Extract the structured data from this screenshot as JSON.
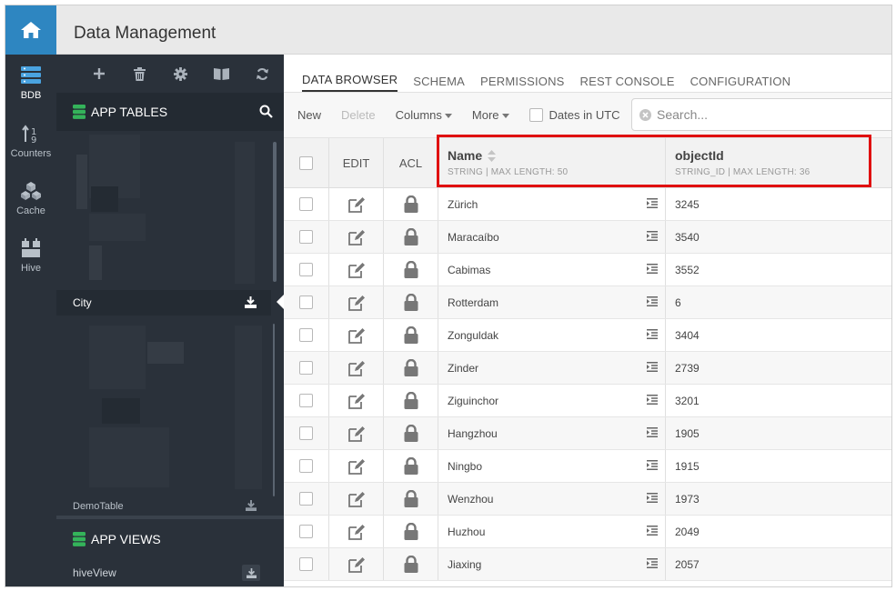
{
  "header": {
    "title": "Data Management"
  },
  "rail": {
    "items": [
      {
        "label": "BDB",
        "icon": "database-icon"
      },
      {
        "label": "Counters",
        "icon": "counters-icon"
      },
      {
        "label": "Cache",
        "icon": "cubes-icon"
      },
      {
        "label": "Hive",
        "icon": "hive-icon"
      }
    ]
  },
  "sidebar": {
    "tables_title": "APP TABLES",
    "selected_table": "City",
    "last_table": "DemoTable",
    "views_title": "APP VIEWS",
    "view_item": "hiveView"
  },
  "tabs": [
    {
      "label": "DATA BROWSER"
    },
    {
      "label": "SCHEMA"
    },
    {
      "label": "PERMISSIONS"
    },
    {
      "label": "REST CONSOLE"
    },
    {
      "label": "CONFIGURATION"
    }
  ],
  "toolbar": {
    "new_label": "New",
    "delete_label": "Delete",
    "columns_label": "Columns",
    "more_label": "More",
    "dates_label": "Dates in UTC",
    "search_placeholder": "Search..."
  },
  "table": {
    "headers": {
      "edit": "EDIT",
      "acl": "ACL",
      "name": "Name",
      "name_meta": "STRING | MAX LENGTH: 50",
      "objectid": "objectId",
      "objectid_meta": "STRING_ID | MAX LENGTH: 36"
    },
    "rows": [
      {
        "name": "Zürich",
        "objectId": "3245"
      },
      {
        "name": "Maracaíbo",
        "objectId": "3540"
      },
      {
        "name": "Cabimas",
        "objectId": "3552"
      },
      {
        "name": "Rotterdam",
        "objectId": "6"
      },
      {
        "name": "Zonguldak",
        "objectId": "3404"
      },
      {
        "name": "Zinder",
        "objectId": "2739"
      },
      {
        "name": "Ziguinchor",
        "objectId": "3201"
      },
      {
        "name": "Hangzhou",
        "objectId": "1905"
      },
      {
        "name": "Ningbo",
        "objectId": "1915"
      },
      {
        "name": "Wenzhou",
        "objectId": "1973"
      },
      {
        "name": "Huzhou",
        "objectId": "2049"
      },
      {
        "name": "Jiaxing",
        "objectId": "2057"
      }
    ]
  },
  "colors": {
    "accent": "#2e86c1",
    "sidebar": "#2a313a",
    "green_icon": "#34b35a",
    "highlight": "#e01010"
  }
}
